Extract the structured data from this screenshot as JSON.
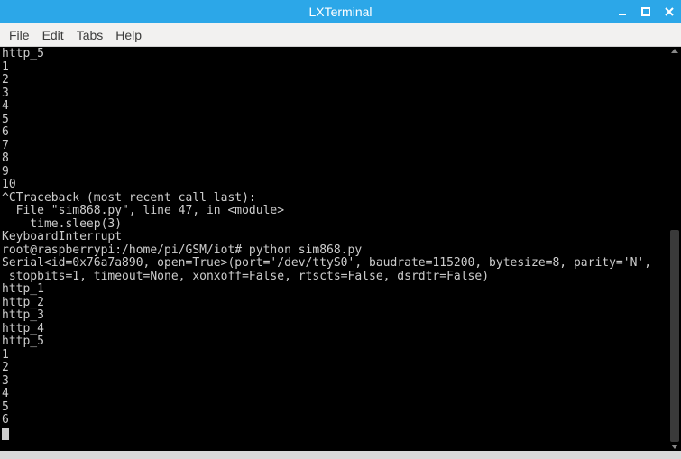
{
  "window": {
    "title": "LXTerminal"
  },
  "menu": {
    "file": "File",
    "edit": "Edit",
    "tabs": "Tabs",
    "help": "Help"
  },
  "terminal": {
    "lines": [
      "http_5",
      "1",
      "2",
      "3",
      "4",
      "5",
      "6",
      "7",
      "8",
      "9",
      "10",
      "^CTraceback (most recent call last):",
      "  File \"sim868.py\", line 47, in <module>",
      "    time.sleep(3)",
      "KeyboardInterrupt",
      "root@raspberrypi:/home/pi/GSM/iot# python sim868.py",
      "Serial<id=0x76a7a890, open=True>(port='/dev/ttyS0', baudrate=115200, bytesize=8, parity='N',",
      " stopbits=1, timeout=None, xonxoff=False, rtscts=False, dsrdtr=False)",
      "http_1",
      "http_2",
      "http_3",
      "http_4",
      "http_5",
      "1",
      "2",
      "3",
      "4",
      "5",
      "6"
    ]
  }
}
